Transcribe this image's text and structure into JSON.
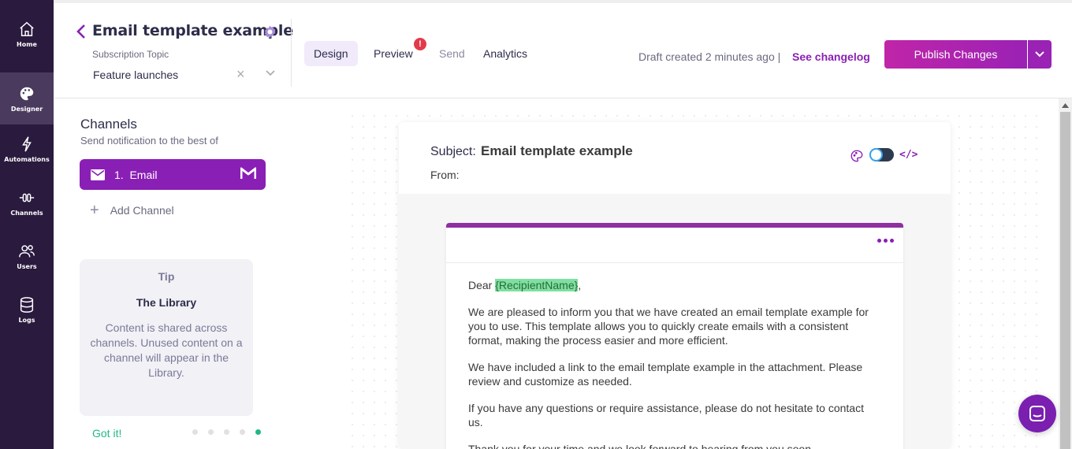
{
  "sidebar": {
    "items": [
      {
        "label": "Home",
        "icon": "home-icon"
      },
      {
        "label": "Designer",
        "icon": "palette-icon"
      },
      {
        "label": "Automations",
        "icon": "lightning-icon"
      },
      {
        "label": "Channels",
        "icon": "channels-icon"
      },
      {
        "label": "Users",
        "icon": "users-icon"
      },
      {
        "label": "Logs",
        "icon": "database-icon"
      }
    ],
    "active": "Designer"
  },
  "header": {
    "title": "Email template example",
    "subscription_label": "Subscription Topic",
    "subscription_value": "Feature launches",
    "tabs": [
      {
        "label": "Design"
      },
      {
        "label": "Preview"
      },
      {
        "label": "Send"
      },
      {
        "label": "Analytics"
      }
    ],
    "preview_warning": "!",
    "draft_text": "Draft created 2 minutes ago |",
    "changelog_link": "See changelog",
    "publish_label": "Publish Changes"
  },
  "channels": {
    "title": "Channels",
    "subtitle": "Send notification to the best of",
    "items": [
      {
        "label": "1.  Email"
      }
    ],
    "add_label": "Add Channel"
  },
  "tip": {
    "heading": "Tip",
    "title": "The Library",
    "body": "Content is shared across channels. Unused content on a channel will appear in the Library.",
    "action": "Got it!",
    "page_count": 5,
    "active_page": 5
  },
  "email": {
    "subject_label": "Subject:",
    "subject_value": "Email template example",
    "from_label": "From:",
    "code_label": "</>",
    "greeting_prefix": "Dear ",
    "recipient_tag": "{RecipientName}",
    "greeting_suffix": ",",
    "paragraphs": [
      "We are pleased to inform you that we have created an email template example for you to use. This template allows you to quickly create emails with a consistent format, making the process easier and more efficient.",
      "We have included a link to the email template example in the attachment. Please review and customize as needed.",
      "If you have any questions or require assistance, please do not hesitate to contact us.",
      "Thank you for your time and we look forward to hearing from you soon."
    ]
  },
  "colors": {
    "sidebar_bg": "#2a1a3e",
    "accent": "#8a1fb5",
    "publish_gradient_start": "#c025a8",
    "success": "#23b882",
    "warning": "#e23b4b"
  }
}
